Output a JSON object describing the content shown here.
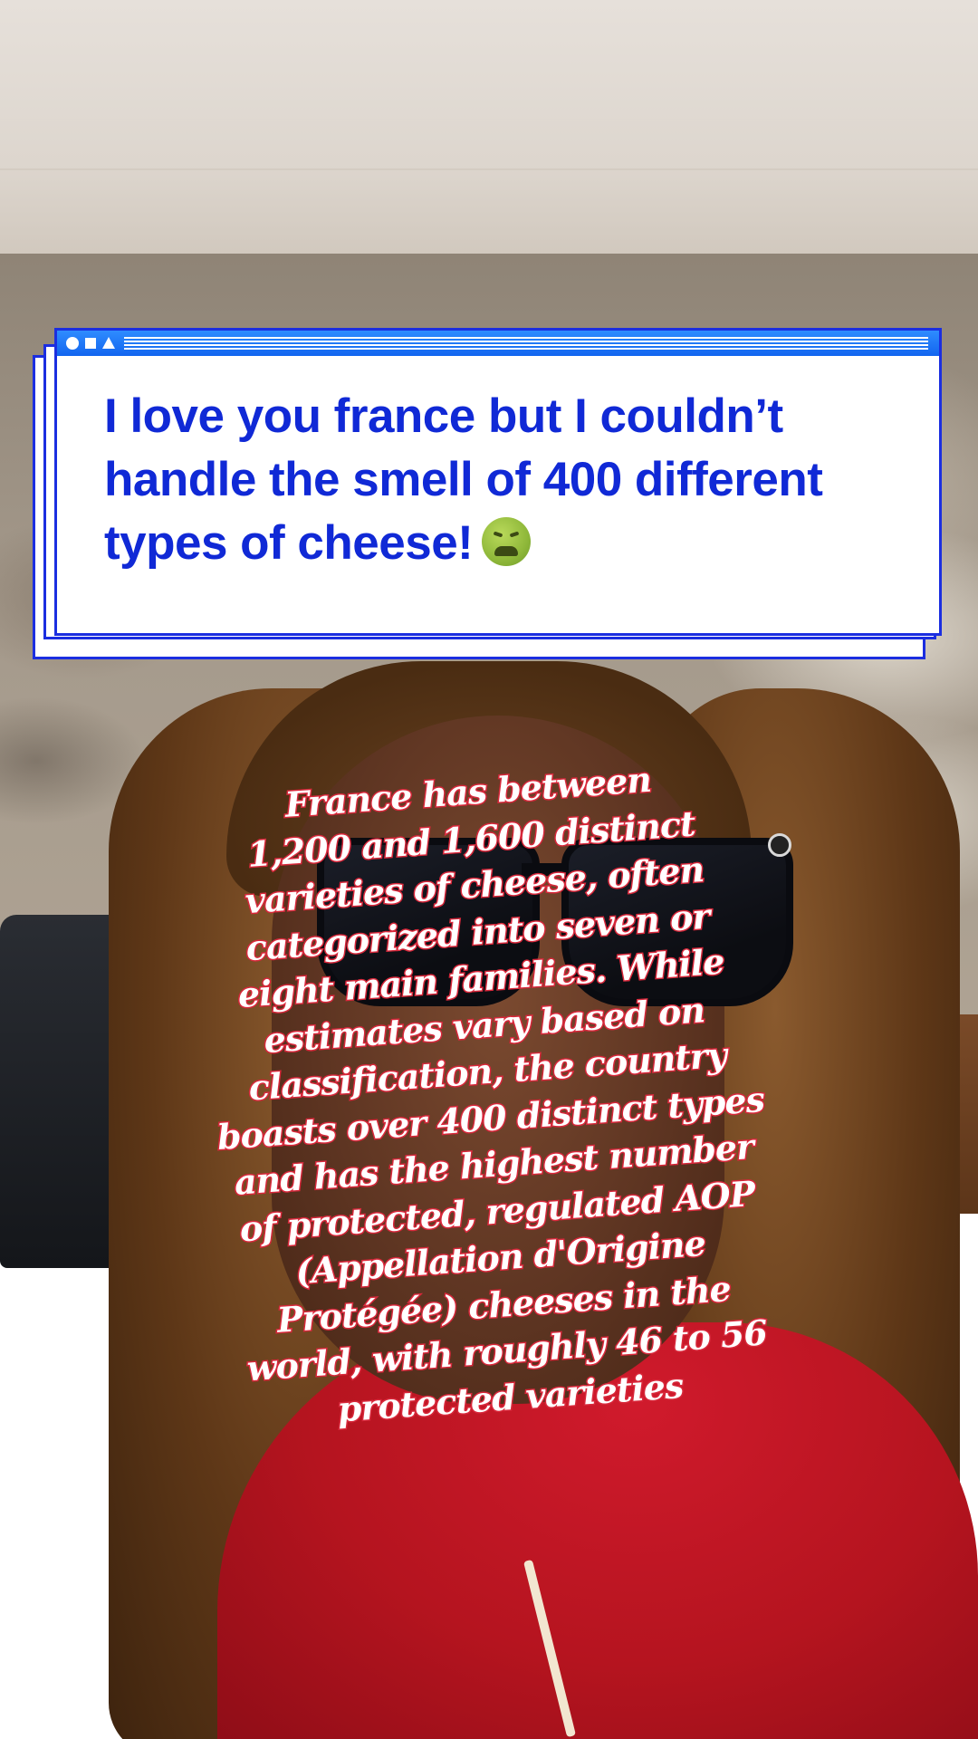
{
  "caption_card": {
    "text": "I love you france but I couldn’t handle the smell of 400 different types of cheese!",
    "emoji": "nauseated-face-icon"
  },
  "fact_overlay": {
    "lines": [
      "France has between",
      "1,200 and 1,600 distinct",
      "varieties of cheese, often",
      "categorized into seven or",
      "eight main families. While",
      "estimates vary based on",
      "classification, the country",
      "boasts over 400 distinct types",
      "and has the highest number",
      "of protected, regulated AOP",
      "(Appellation d'Origine",
      "Protégée) cheeses in the",
      "world, with roughly 46 to 56",
      "protected varieties"
    ],
    "fill_color": "#ffffff",
    "outline_color": "#d8283b"
  },
  "colors": {
    "caption_text": "#1029d6",
    "window_border": "#1b2ee0",
    "title_bar": "#1f74f5"
  }
}
